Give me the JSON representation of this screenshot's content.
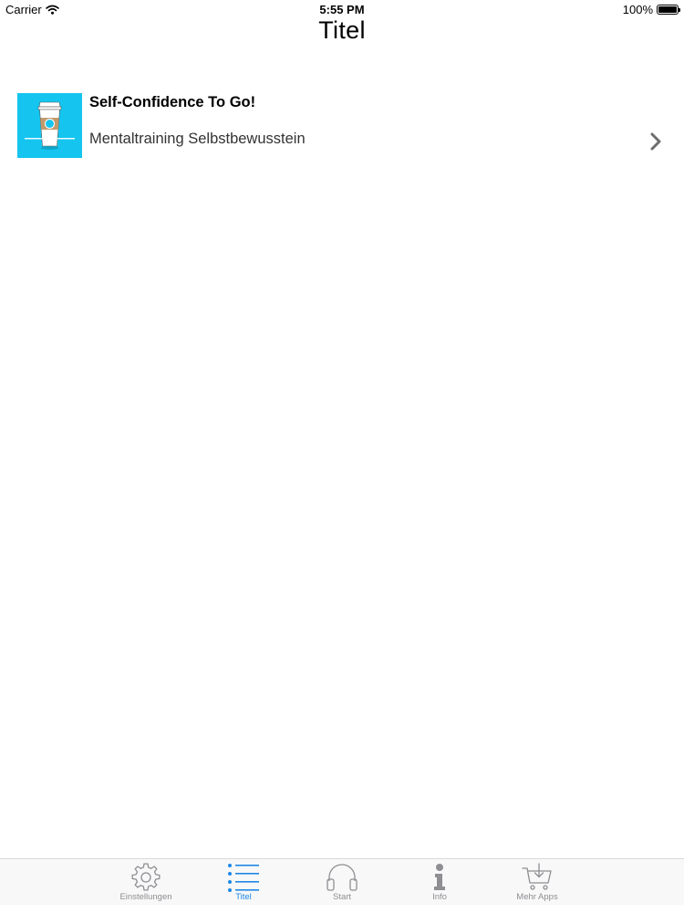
{
  "status_bar": {
    "carrier": "Carrier",
    "time": "5:55 PM",
    "battery": "100%",
    "battery_level": 1.0
  },
  "nav": {
    "title": "Titel"
  },
  "list": {
    "items": [
      {
        "title": "Self-Confidence To Go!",
        "subtitle": "Mentaltraining Selbstbewusstein",
        "thumbnail_icon": "coffee-cup-icon",
        "thumbnail_color": "#15c5ef"
      }
    ]
  },
  "tab_bar": {
    "active_color": "#1e88e5",
    "inactive_color": "#8e8e93",
    "tabs": [
      {
        "label": "Einstellungen",
        "icon": "gear-icon",
        "active": false
      },
      {
        "label": "Titel",
        "icon": "list-icon",
        "active": true
      },
      {
        "label": "Start",
        "icon": "headphones-icon",
        "active": false
      },
      {
        "label": "Info",
        "icon": "info-icon",
        "active": false
      },
      {
        "label": "Mehr Apps",
        "icon": "cart-icon",
        "active": false
      }
    ]
  }
}
